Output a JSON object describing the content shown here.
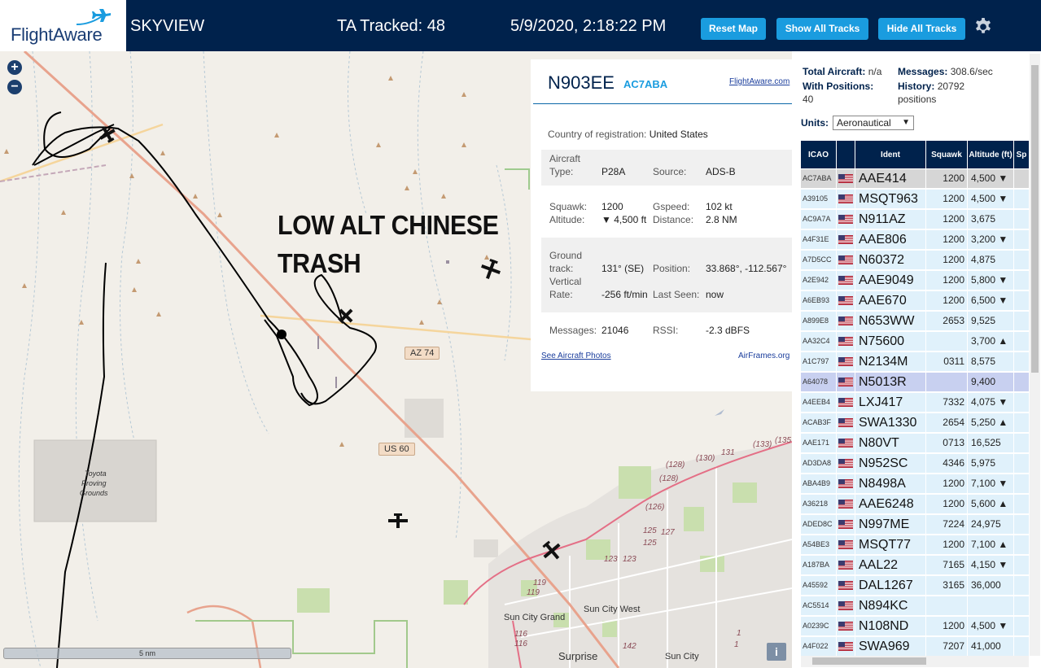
{
  "header": {
    "logo": "FlightAware",
    "app_title": "SKYVIEW",
    "tracked": "TA Tracked: 48",
    "datetime": "5/9/2020, 2:18:22 PM",
    "buttons": {
      "reset": "Reset Map",
      "show_all": "Show All Tracks",
      "hide_all": "Hide All Tracks"
    },
    "icons": {
      "settings": "gear-icon",
      "logo": "airplane-icon"
    }
  },
  "map": {
    "zoom_in": "+",
    "zoom_out": "−",
    "annotation_line1": "LOW ALT CHINESE",
    "annotation_line2": "TRASH",
    "labels": {
      "toyota1": "Toyota",
      "toyota2": "Proving",
      "toyota3": "Grounds",
      "sun_city_grand": "Sun City Grand",
      "sun_city_west": "Sun City West",
      "surprise": "Surprise",
      "sun_city": "Sun City"
    },
    "roads": {
      "az74": "AZ 74",
      "us60": "US 60"
    },
    "route_numbers": [
      "(128)",
      "(130)",
      "131",
      "(133)",
      "(135",
      "(128)",
      "(126)",
      "127",
      "125",
      "125",
      "123",
      "123",
      "119",
      "119",
      "116",
      "116",
      "142",
      "1",
      "1"
    ],
    "scale": "5 nm",
    "info": "i",
    "colors": {
      "land": "#f2efe9",
      "road_major": "#e8a38d",
      "road_minor": "#f5d59c",
      "terrain": "#c49a72"
    }
  },
  "popup": {
    "callsign": "N903EE",
    "icao": "AC7ABA",
    "fa_link": "FlightAware.com",
    "country_label": "Country of registration:",
    "country": "United States",
    "aircraft_type_label1": "Aircraft",
    "aircraft_type_label2": "Type:",
    "aircraft_type": "P28A",
    "source_label": "Source:",
    "source": "ADS-B",
    "squawk_label": "Squawk:",
    "squawk": "1200",
    "gspeed_label": "Gspeed:",
    "gspeed": "102 kt",
    "altitude_label": "Altitude:",
    "altitude": "▼ 4,500 ft",
    "distance_label": "Distance:",
    "distance": "2.8 NM",
    "ground_label1": "Ground",
    "ground_label2": "track:",
    "ground_track": "131° (SE)",
    "position_label": "Position:",
    "position": "33.868°, -112.567°",
    "vrate_label1": "Vertical",
    "vrate_label2": "Rate:",
    "vrate": "-256 ft/min",
    "last_seen_label": "Last Seen:",
    "last_seen": "now",
    "messages_label": "Messages:",
    "messages": "21046",
    "rssi_label": "RSSI:",
    "rssi": "-2.3 dBFS",
    "photos_link": "See Aircraft Photos",
    "airframes_link": "AirFrames.org"
  },
  "sidebar": {
    "total_label": "Total Aircraft:",
    "total": "n/a",
    "messages_label": "Messages:",
    "messages": "308.6/sec",
    "positions_label": "With Positions:",
    "positions": "40",
    "history_label": "History:",
    "history": "20792",
    "history_unit": "positions",
    "units_label": "Units:",
    "units_value": "Aeronautical",
    "columns": [
      "ICAO",
      "Ident",
      "Squawk",
      "Altitude (ft)",
      "Sp"
    ],
    "rows": [
      {
        "icao": "AC7ABA",
        "ident": "AAE414",
        "squawk": "1200",
        "alt": "4,500 ▼"
      },
      {
        "icao": "A39105",
        "ident": "MSQT963",
        "squawk": "1200",
        "alt": "4,500 ▼"
      },
      {
        "icao": "AC9A7A",
        "ident": "N911AZ",
        "squawk": "1200",
        "alt": "3,675"
      },
      {
        "icao": "A4F31E",
        "ident": "AAE806",
        "squawk": "1200",
        "alt": "3,200 ▼"
      },
      {
        "icao": "A7D5CC",
        "ident": "N60372",
        "squawk": "1200",
        "alt": "4,875"
      },
      {
        "icao": "A2E942",
        "ident": "AAE9049",
        "squawk": "1200",
        "alt": "5,800 ▼"
      },
      {
        "icao": "A6EB93",
        "ident": "AAE670",
        "squawk": "1200",
        "alt": "6,500 ▼"
      },
      {
        "icao": "A899E8",
        "ident": "N653WW",
        "squawk": "2653",
        "alt": "9,525"
      },
      {
        "icao": "AA32C4",
        "ident": "N75600",
        "squawk": "",
        "alt": "3,700 ▲"
      },
      {
        "icao": "A1C797",
        "ident": "N2134M",
        "squawk": "0311",
        "alt": "8,575"
      },
      {
        "icao": "A64078",
        "ident": "N5013R",
        "squawk": "",
        "alt": "9,400"
      },
      {
        "icao": "A4EEB4",
        "ident": "LXJ417",
        "squawk": "7332",
        "alt": "4,075 ▼"
      },
      {
        "icao": "ACAB3F",
        "ident": "SWA1330",
        "squawk": "2654",
        "alt": "5,250 ▲"
      },
      {
        "icao": "AAE171",
        "ident": "N80VT",
        "squawk": "0713",
        "alt": "16,525"
      },
      {
        "icao": "AD3DA8",
        "ident": "N952SC",
        "squawk": "4346",
        "alt": "5,975"
      },
      {
        "icao": "ABA4B9",
        "ident": "N8498A",
        "squawk": "1200",
        "alt": "7,100 ▼"
      },
      {
        "icao": "A36218",
        "ident": "AAE6248",
        "squawk": "1200",
        "alt": "5,600 ▲"
      },
      {
        "icao": "ADED8C",
        "ident": "N997ME",
        "squawk": "7224",
        "alt": "24,975"
      },
      {
        "icao": "A54BE3",
        "ident": "MSQT77",
        "squawk": "1200",
        "alt": "7,100 ▲"
      },
      {
        "icao": "A187BA",
        "ident": "AAL22",
        "squawk": "7165",
        "alt": "4,150 ▼"
      },
      {
        "icao": "A45592",
        "ident": "DAL1267",
        "squawk": "3165",
        "alt": "36,000"
      },
      {
        "icao": "AC5514",
        "ident": "N894KC",
        "squawk": "",
        "alt": ""
      },
      {
        "icao": "A0239C",
        "ident": "N108ND",
        "squawk": "1200",
        "alt": "4,500 ▼"
      },
      {
        "icao": "A4F022",
        "ident": "SWA969",
        "squawk": "7207",
        "alt": "41,000"
      }
    ]
  }
}
